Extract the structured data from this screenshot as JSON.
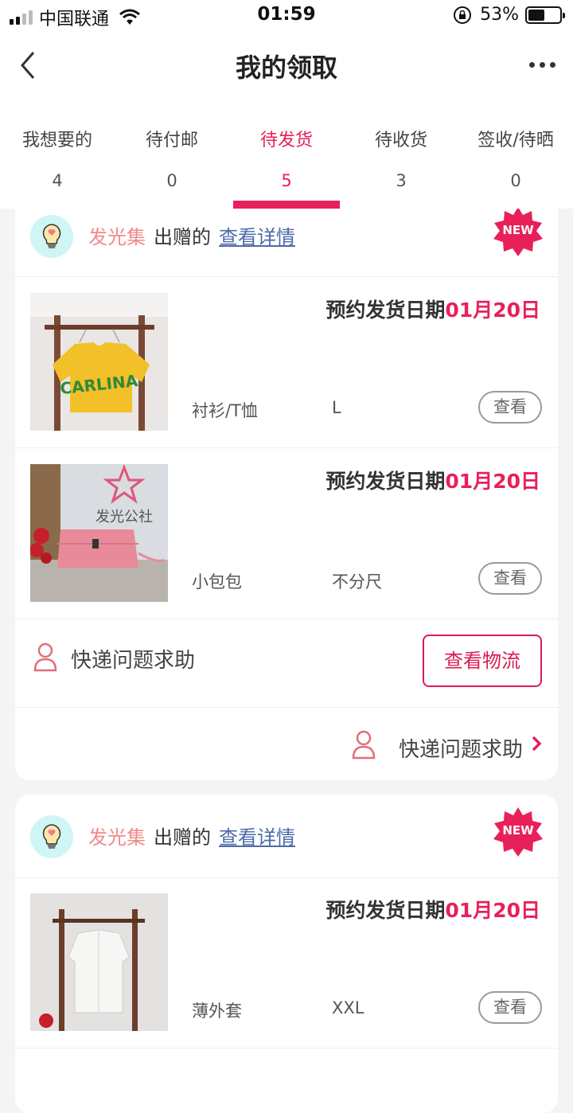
{
  "status_bar": {
    "carrier": "中国联通",
    "time": "01:59",
    "battery_pct": "53%",
    "battery_level": 0.53
  },
  "nav": {
    "title": "我的领取"
  },
  "tabs": [
    {
      "label": "我想要的",
      "count": "4"
    },
    {
      "label": "待付邮",
      "count": "0"
    },
    {
      "label": "待发货",
      "count": "5",
      "active": true
    },
    {
      "label": "待收货",
      "count": "3"
    },
    {
      "label": "签收/待晒",
      "count": "0"
    }
  ],
  "colors": {
    "accent": "#e8205a",
    "brand_text": "#f08a8a",
    "link": "#4d6aa8",
    "bulb_bg": "#cff5f5"
  },
  "orders": [
    {
      "brand": "发光集",
      "gift_text": "出赠的",
      "detail_link": "查看详情",
      "badge": "NEW",
      "items": [
        {
          "ship_prefix": "预约发货日期",
          "ship_date": "01月20日",
          "category": "衬衫/T恤",
          "size": "L",
          "view": "查看",
          "image": "yellow-tshirt-on-rack",
          "image_text": "CARLINA"
        },
        {
          "ship_prefix": "预约发货日期",
          "ship_date": "01月20日",
          "category": "小包包",
          "size": "不分尺",
          "view": "查看",
          "image": "pink-handbag",
          "image_text": "发光公社"
        }
      ],
      "help_label": "快递问题求助",
      "logistics_button": "查看物流",
      "help_link": "快递问题求助"
    },
    {
      "brand": "发光集",
      "gift_text": "出赠的",
      "detail_link": "查看详情",
      "badge": "NEW",
      "items": [
        {
          "ship_prefix": "预约发货日期",
          "ship_date": "01月20日",
          "category": "薄外套",
          "size": "XXL",
          "view": "查看",
          "image": "white-jacket-on-rack"
        }
      ]
    }
  ]
}
